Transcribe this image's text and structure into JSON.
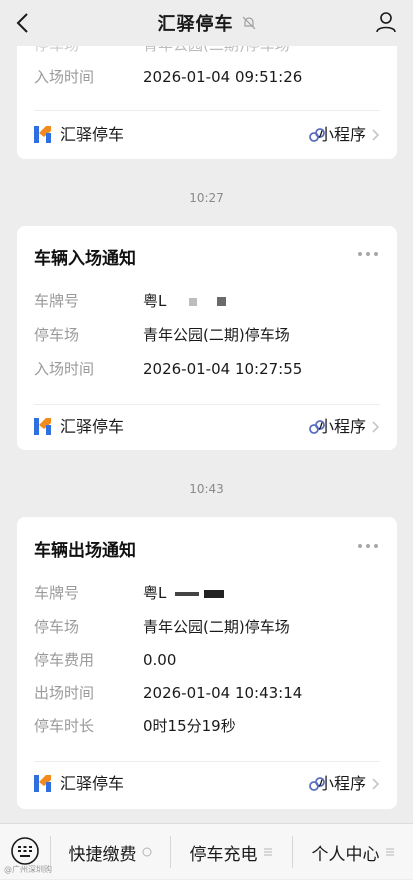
{
  "header": {
    "title": "汇驿停车"
  },
  "cards": [
    {
      "rows": [
        {
          "label": "入场时间",
          "value": "2026-01-04 09:51:26"
        }
      ],
      "brand": "汇驿停车",
      "mini_program": "小程序"
    },
    {
      "time": "10:27",
      "title": "车辆入场通知",
      "plate_label": "车牌号",
      "plate_value": "粤L",
      "rows": [
        {
          "label": "停车场",
          "value": "青年公园(二期)停车场"
        },
        {
          "label": "入场时间",
          "value": "2026-01-04 10:27:55"
        }
      ],
      "brand": "汇驿停车",
      "mini_program": "小程序"
    },
    {
      "time": "10:43",
      "title": "车辆出场通知",
      "plate_label": "车牌号",
      "plate_value": "粤L",
      "rows": [
        {
          "label": "停车场",
          "value": "青年公园(二期)停车场"
        },
        {
          "label": "停车费用",
          "value": "0.00"
        },
        {
          "label": "出场时间",
          "value": "2026-01-04 10:43:14"
        },
        {
          "label": "停车时长",
          "value": "0时15分19秒"
        }
      ],
      "brand": "汇驿停车",
      "mini_program": "小程序"
    }
  ],
  "bottom_menu": {
    "items": [
      {
        "label": "快捷缴费"
      },
      {
        "label": "停车充电"
      },
      {
        "label": "个人中心"
      }
    ]
  },
  "watermark": "@广州深圳购"
}
